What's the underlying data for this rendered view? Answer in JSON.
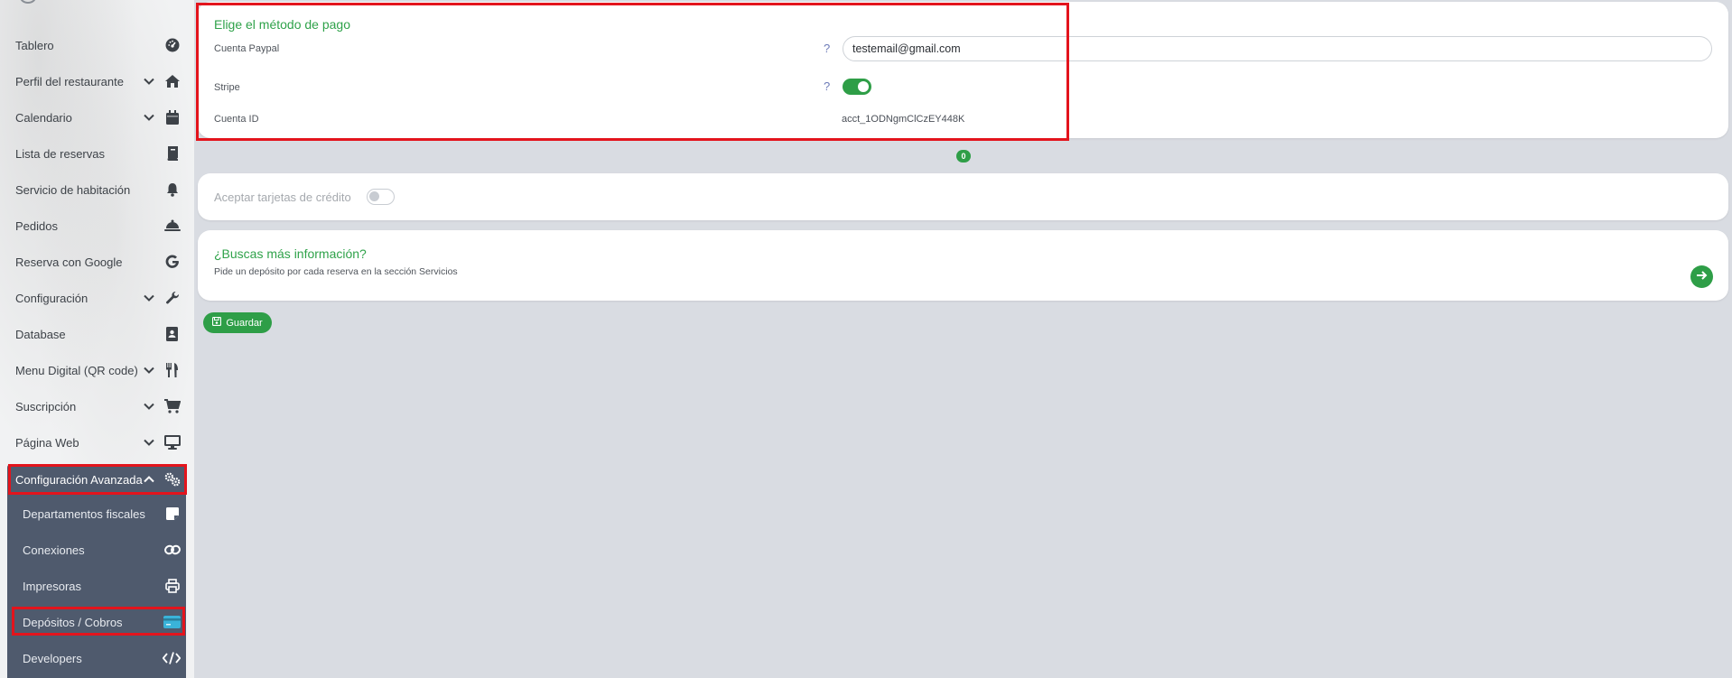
{
  "sidebar": {
    "items": [
      {
        "label": "Tablero",
        "icon": "dashboard-icon",
        "has_chevron": false
      },
      {
        "label": "Perfil del restaurante",
        "icon": "home-icon",
        "has_chevron": true
      },
      {
        "label": "Calendario",
        "icon": "calendar-icon",
        "has_chevron": true
      },
      {
        "label": "Lista de reservas",
        "icon": "book-icon",
        "has_chevron": false
      },
      {
        "label": "Servicio de habitación",
        "icon": "bell-icon",
        "has_chevron": false
      },
      {
        "label": "Pedidos",
        "icon": "cloche-icon",
        "has_chevron": false
      },
      {
        "label": "Reserva con Google",
        "icon": "google-icon",
        "has_chevron": false
      },
      {
        "label": "Configuración",
        "icon": "wrench-icon",
        "has_chevron": true
      },
      {
        "label": "Database",
        "icon": "address-book-icon",
        "has_chevron": false
      },
      {
        "label": "Menu Digital (QR code)",
        "icon": "utensils-icon",
        "has_chevron": true
      },
      {
        "label": "Suscripción",
        "icon": "cart-icon",
        "has_chevron": true
      },
      {
        "label": "Página Web",
        "icon": "monitor-icon",
        "has_chevron": true
      }
    ],
    "advanced": {
      "label": "Configuración Avanzada",
      "icon": "gears-icon",
      "subitems": [
        {
          "label": "Departamentos fiscales",
          "icon": "sticky-note-icon"
        },
        {
          "label": "Conexiones",
          "icon": "link-icon"
        },
        {
          "label": "Impresoras",
          "icon": "printer-icon"
        },
        {
          "label": "Depósitos / Cobros",
          "icon": "credit-card-icon"
        },
        {
          "label": "Developers",
          "icon": "code-icon"
        }
      ]
    }
  },
  "payment": {
    "title": "Elige el método de pago",
    "paypal_label": "Cuenta Paypal",
    "paypal_value": "testemail@gmail.com",
    "help_mark": "?",
    "stripe_label": "Stripe",
    "stripe_enabled": true,
    "account_id_label": "Cuenta ID",
    "account_id_value": "acct_1ODNgmClCzEY448K"
  },
  "badge": "0",
  "credit_cards": {
    "label": "Aceptar tarjetas de crédito",
    "enabled": false
  },
  "info": {
    "title": "¿Buscas más información?",
    "text": "Pide un depósito por cada reserva en la sección Servicios"
  },
  "save_label": "Guardar",
  "colors": {
    "accent": "#2e9e47",
    "highlight": "#e3141c",
    "sidebar_dark": "#4f5a6d",
    "active_icon": "#3ab3d9"
  }
}
